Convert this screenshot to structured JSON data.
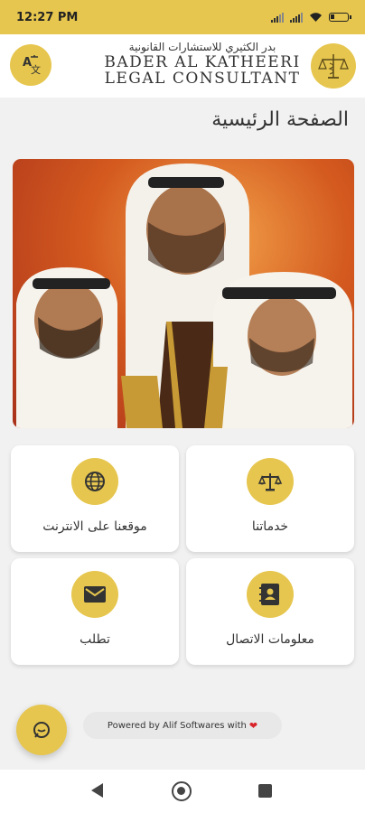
{
  "status_bar": {
    "time": "12:27 PM"
  },
  "header": {
    "logo_arabic": "بدر الكثيري للاستشارات القانونية",
    "logo_english_line1": "BADER AL KATHEERI",
    "logo_english_line2": "LEGAL CONSULTANT",
    "translate_icon": "translate-icon",
    "logo_icon": "scales-caduceus-icon"
  },
  "page": {
    "title": "الصفحة الرئيسية"
  },
  "tiles": [
    {
      "label": "موقعنا على الانترنت",
      "icon": "globe-icon"
    },
    {
      "label": "خدماتنا",
      "icon": "scales-icon"
    },
    {
      "label": "تطلب",
      "icon": "mail-icon"
    },
    {
      "label": "معلومات الاتصال",
      "icon": "contact-book-icon"
    }
  ],
  "footer": {
    "powered_by": "Powered by Alif Softwares with",
    "heart": "❤"
  },
  "colors": {
    "accent": "#e6c64e",
    "background": "#f1f1f1"
  }
}
